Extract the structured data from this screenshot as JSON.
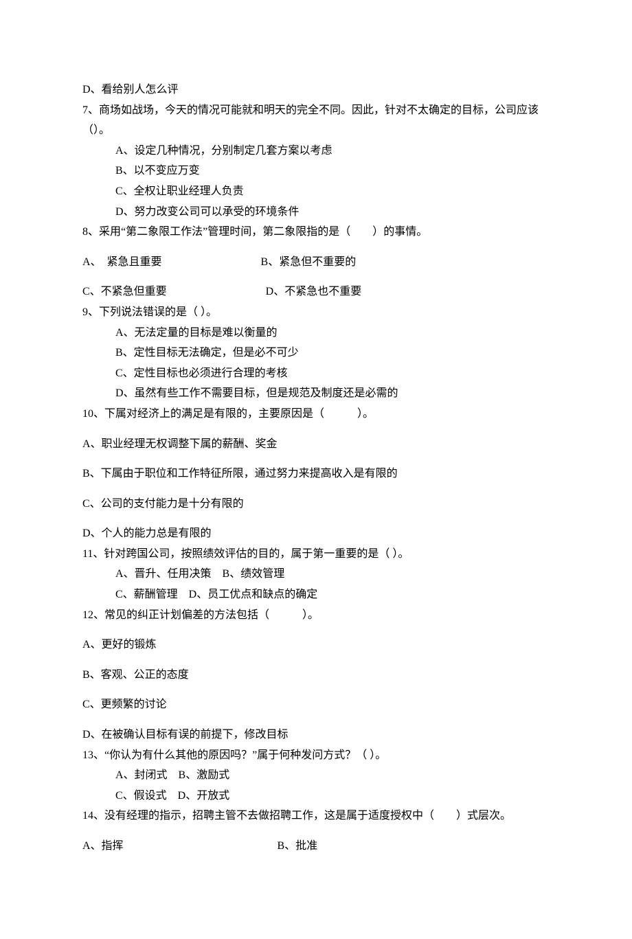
{
  "lines": [
    {
      "text": "D、看给别人怎么评",
      "indent": false,
      "gap": false
    },
    {
      "text": "7、商场如战场，今天的情况可能就和明天的完全不同。因此，针对不太确定的目标，公司应该（）。",
      "indent": false,
      "gap": false
    },
    {
      "text": "A、设定几种情况，分别制定几套方案以考虑",
      "indent": true,
      "gap": false
    },
    {
      "text": "B、以不变应万变",
      "indent": true,
      "gap": false
    },
    {
      "text": "C、全权让职业经理人负责",
      "indent": true,
      "gap": false
    },
    {
      "text": "D、努力改变公司可以承受的环境条件",
      "indent": true,
      "gap": false
    },
    {
      "text": "8、采用“第二象限工作法”管理时间，第二象限指的是（　　）的事情。",
      "indent": false,
      "gap": false
    },
    {
      "text": "A、　紧急且重要　　　　　　　　　B、紧急但不重要的",
      "indent": false,
      "gap": true
    },
    {
      "text": "C、不紧急但重要　　　　　　　　　D、不紧急也不重要",
      "indent": false,
      "gap": true
    },
    {
      "text": "9、下列说法错误的是（ ）。",
      "indent": false,
      "gap": false
    },
    {
      "text": "A、无法定量的目标是难以衡量的",
      "indent": true,
      "gap": false
    },
    {
      "text": "B、定性目标无法确定，但是必不可少",
      "indent": true,
      "gap": false
    },
    {
      "text": "C、定性目标也必须进行合理的考核",
      "indent": true,
      "gap": false
    },
    {
      "text": "D、虽然有些工作不需要目标，但是规范及制度还是必需的",
      "indent": true,
      "gap": false
    },
    {
      "text": "10、下属对经济上的满足是有限的，主要原因是（　　　）。",
      "indent": false,
      "gap": false
    },
    {
      "text": "A、职业经理无权调整下属的薪酬、奖金",
      "indent": false,
      "gap": true
    },
    {
      "text": "B、下属由于职位和工作特征所限，通过努力来提高收入是有限的",
      "indent": false,
      "gap": true
    },
    {
      "text": "C、公司的支付能力是十分有限的",
      "indent": false,
      "gap": true
    },
    {
      "text": "D、个人的能力总是有限的",
      "indent": false,
      "gap": true
    },
    {
      "text": "11、针对跨国公司，按照绩效评估的目的，属于第一重要的是（ ）。",
      "indent": false,
      "gap": false
    },
    {
      "text": "A、晋升、任用决策　B、绩效管理",
      "indent": true,
      "gap": false
    },
    {
      "text": "C、薪酬管理　D、员工优点和缺点的确定",
      "indent": true,
      "gap": false
    },
    {
      "text": "12、常见的纠正计划偏差的方法包括（　　　）。",
      "indent": false,
      "gap": false
    },
    {
      "text": "A、更好的锻炼",
      "indent": false,
      "gap": true
    },
    {
      "text": "B、客观、公正的态度",
      "indent": false,
      "gap": true
    },
    {
      "text": "C、更频繁的讨论",
      "indent": false,
      "gap": true
    },
    {
      "text": "D、在被确认目标有误的前提下，修改目标",
      "indent": false,
      "gap": true
    },
    {
      "text": "13、“你认为有什么其他的原因吗？”属于何种发问方式？（ ）。",
      "indent": false,
      "gap": false
    },
    {
      "text": "A、封闭式　B、激励式",
      "indent": true,
      "gap": false
    },
    {
      "text": "C、假设式　D、开放式",
      "indent": true,
      "gap": false
    },
    {
      "text": "14、没有经理的指示，招聘主管不去做招聘工作，这是属于适度授权中（　　）式层次。",
      "indent": false,
      "gap": false
    },
    {
      "text": "A、指挥　　　　　　　　　　　　　　B、批准",
      "indent": false,
      "gap": true
    }
  ]
}
